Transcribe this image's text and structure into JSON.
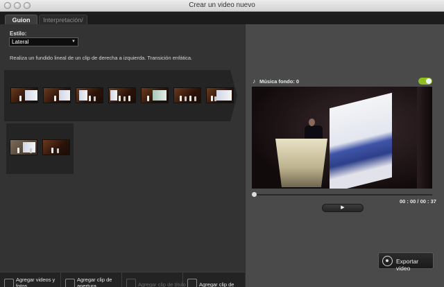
{
  "window": {
    "title": "Crear un video nuevo"
  },
  "tabs": [
    {
      "label": "Guion",
      "active": true
    },
    {
      "label": "Interpretación/",
      "active": false
    }
  ],
  "style": {
    "label": "Estilo:",
    "selected": "Lateral",
    "description": "Realiza un fundido lineal de un clip de derecha a izquierda. Transición enfática."
  },
  "clips_row1": [
    "clip-1",
    "clip-2",
    "clip-3",
    "clip-4",
    "clip-5",
    "clip-6",
    "clip-7"
  ],
  "clips_row2": [
    "clip-8",
    "clip-9"
  ],
  "toolbar": {
    "add_media": "Agregar videos y fotos",
    "add_opening": "Agregar clip de apertura",
    "add_title": "Agregar clip de título",
    "add_closing": "Agregar clip de cierre"
  },
  "music": {
    "label": "Música fondo: 0",
    "enabled": true
  },
  "player": {
    "timecode": "00 : 00 / 00 : 37",
    "play_symbol": "▶",
    "progress": 0.0
  },
  "export": {
    "label": "Exportar video"
  },
  "colors": {
    "toggle_on": "#8fbf1e",
    "panel_dark": "#333333",
    "panel_right": "#4a4a4a"
  }
}
